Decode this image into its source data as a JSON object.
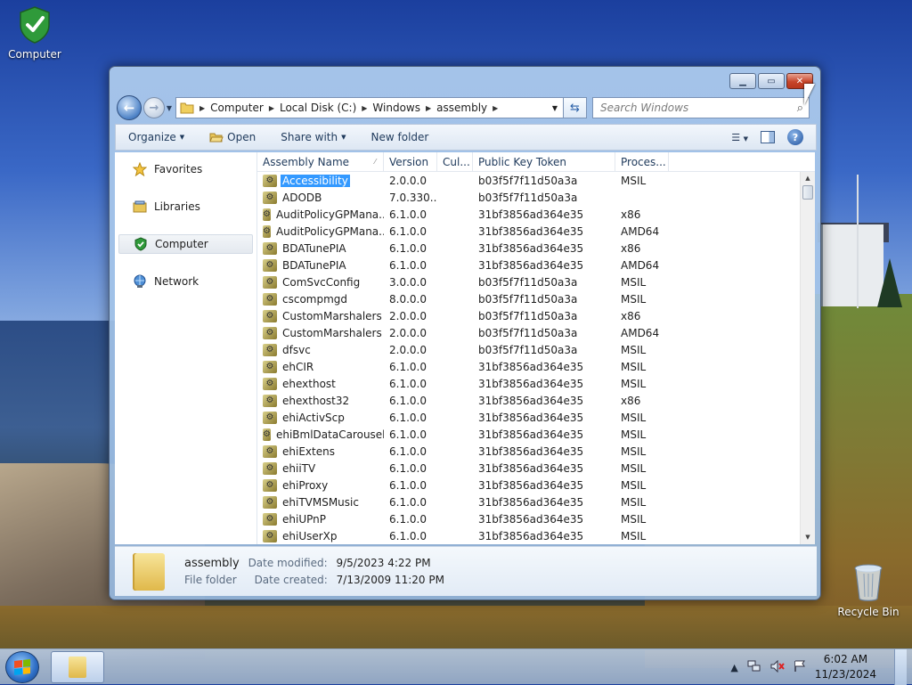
{
  "desktop": {
    "icons": [
      {
        "label": "Computer",
        "icon": "shield-check-icon"
      },
      {
        "label": "Recycle Bin",
        "icon": "recycle-bin-icon"
      }
    ]
  },
  "window": {
    "address": {
      "crumbs": [
        "Computer",
        "Local Disk (C:)",
        "Windows",
        "assembly"
      ]
    },
    "search": {
      "placeholder": "Search Windows"
    },
    "toolbar": {
      "organize": "Organize",
      "open": "Open",
      "share_with": "Share with",
      "new_folder": "New folder"
    },
    "nav": [
      {
        "label": "Favorites",
        "icon": "star-icon"
      },
      {
        "label": "Libraries",
        "icon": "libraries-icon"
      },
      {
        "label": "Computer",
        "icon": "computer-shield-icon",
        "selected": true
      },
      {
        "label": "Network",
        "icon": "network-icon"
      }
    ],
    "columns": [
      "Assembly Name",
      "Version",
      "Cul...",
      "Public Key Token",
      "Proces..."
    ],
    "rows": [
      {
        "name": "Accessibility",
        "version": "2.0.0.0",
        "culture": "",
        "token": "b03f5f7f11d50a3a",
        "arch": "MSIL",
        "selected": true
      },
      {
        "name": "ADODB",
        "version": "7.0.330...",
        "culture": "",
        "token": "b03f5f7f11d50a3a",
        "arch": ""
      },
      {
        "name": "AuditPolicyGPMana...",
        "version": "6.1.0.0",
        "culture": "",
        "token": "31bf3856ad364e35",
        "arch": "x86"
      },
      {
        "name": "AuditPolicyGPMana...",
        "version": "6.1.0.0",
        "culture": "",
        "token": "31bf3856ad364e35",
        "arch": "AMD64"
      },
      {
        "name": "BDATunePIA",
        "version": "6.1.0.0",
        "culture": "",
        "token": "31bf3856ad364e35",
        "arch": "x86"
      },
      {
        "name": "BDATunePIA",
        "version": "6.1.0.0",
        "culture": "",
        "token": "31bf3856ad364e35",
        "arch": "AMD64"
      },
      {
        "name": "ComSvcConfig",
        "version": "3.0.0.0",
        "culture": "",
        "token": "b03f5f7f11d50a3a",
        "arch": "MSIL"
      },
      {
        "name": "cscompmgd",
        "version": "8.0.0.0",
        "culture": "",
        "token": "b03f5f7f11d50a3a",
        "arch": "MSIL"
      },
      {
        "name": "CustomMarshalers",
        "version": "2.0.0.0",
        "culture": "",
        "token": "b03f5f7f11d50a3a",
        "arch": "x86"
      },
      {
        "name": "CustomMarshalers",
        "version": "2.0.0.0",
        "culture": "",
        "token": "b03f5f7f11d50a3a",
        "arch": "AMD64"
      },
      {
        "name": "dfsvc",
        "version": "2.0.0.0",
        "culture": "",
        "token": "b03f5f7f11d50a3a",
        "arch": "MSIL"
      },
      {
        "name": "ehCIR",
        "version": "6.1.0.0",
        "culture": "",
        "token": "31bf3856ad364e35",
        "arch": "MSIL"
      },
      {
        "name": "ehexthost",
        "version": "6.1.0.0",
        "culture": "",
        "token": "31bf3856ad364e35",
        "arch": "MSIL"
      },
      {
        "name": "ehexthost32",
        "version": "6.1.0.0",
        "culture": "",
        "token": "31bf3856ad364e35",
        "arch": "x86"
      },
      {
        "name": "ehiActivScp",
        "version": "6.1.0.0",
        "culture": "",
        "token": "31bf3856ad364e35",
        "arch": "MSIL"
      },
      {
        "name": "ehiBmlDataCarousel",
        "version": "6.1.0.0",
        "culture": "",
        "token": "31bf3856ad364e35",
        "arch": "MSIL"
      },
      {
        "name": "ehiExtens",
        "version": "6.1.0.0",
        "culture": "",
        "token": "31bf3856ad364e35",
        "arch": "MSIL"
      },
      {
        "name": "ehiiTV",
        "version": "6.1.0.0",
        "culture": "",
        "token": "31bf3856ad364e35",
        "arch": "MSIL"
      },
      {
        "name": "ehiProxy",
        "version": "6.1.0.0",
        "culture": "",
        "token": "31bf3856ad364e35",
        "arch": "MSIL"
      },
      {
        "name": "ehiTVMSMusic",
        "version": "6.1.0.0",
        "culture": "",
        "token": "31bf3856ad364e35",
        "arch": "MSIL"
      },
      {
        "name": "ehiUPnP",
        "version": "6.1.0.0",
        "culture": "",
        "token": "31bf3856ad364e35",
        "arch": "MSIL"
      },
      {
        "name": "ehiUserXp",
        "version": "6.1.0.0",
        "culture": "",
        "token": "31bf3856ad364e35",
        "arch": "MSIL"
      }
    ],
    "details": {
      "name": "assembly",
      "type": "File folder",
      "modified_label": "Date modified:",
      "modified_value": "9/5/2023 4:22 PM",
      "created_label": "Date created:",
      "created_value": "7/13/2009 11:20 PM"
    }
  },
  "taskbar": {
    "time": "6:02 AM",
    "date": "11/23/2024"
  },
  "colors": {
    "selection": "#3399ff",
    "close_button": "#c7452a",
    "accent": "#2f6fc6"
  }
}
